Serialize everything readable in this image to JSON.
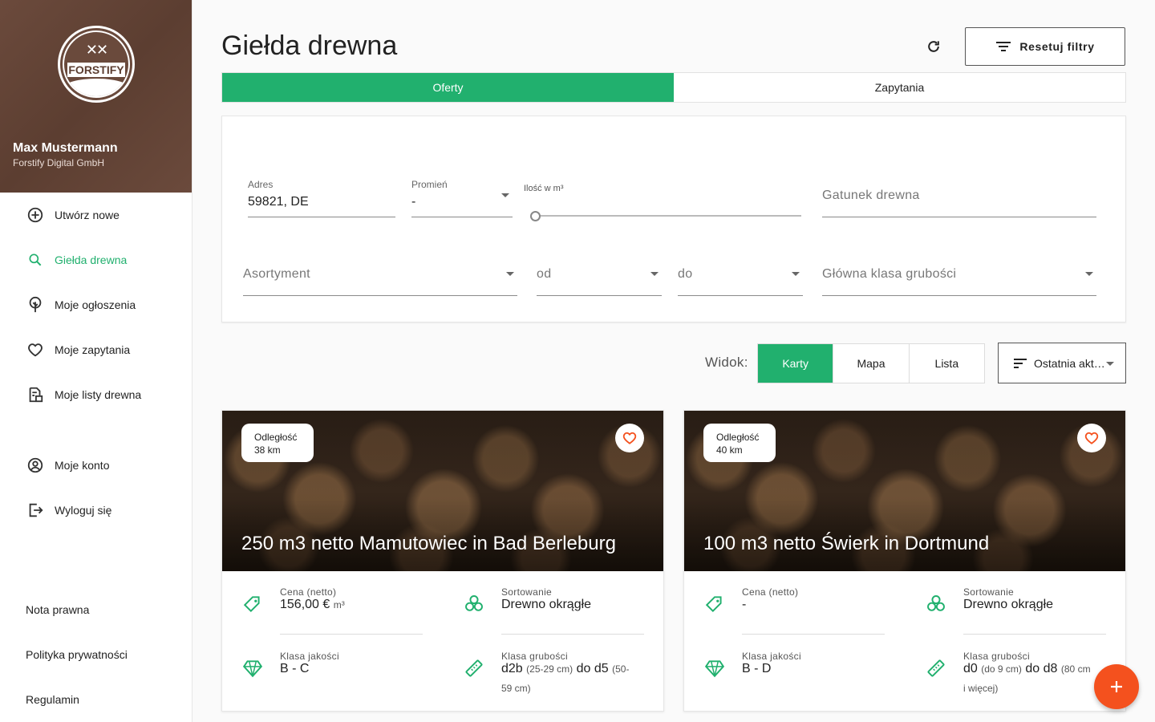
{
  "user": {
    "name": "Max Mustermann",
    "company": "Forstify Digital GmbH"
  },
  "logo_text": "FORSTIFY",
  "nav": {
    "create": "Utwórz nowe",
    "exchange": "Giełda drewna",
    "my_listings": "Moje ogłoszenia",
    "my_requests": "Moje zapytania",
    "my_lists": "Moje listy drewna",
    "account": "Moje konto",
    "logout": "Wyloguj się"
  },
  "footer_links": {
    "legal": "Nota prawna",
    "privacy": "Polityka prywatności",
    "terms": "Regulamin"
  },
  "page": {
    "title": "Giełda drewna",
    "reset_filters": "Resetuj filtry"
  },
  "tabs": {
    "offers": "Oferty",
    "requests": "Zapytania"
  },
  "filters": {
    "address_label": "Adres",
    "address_value": "59821, DE",
    "radius_label": "Promień",
    "radius_value": "-",
    "quantity_label": "Ilość w m³",
    "species_placeholder": "Gatunek drewna",
    "assortment_placeholder": "Asortyment",
    "from_placeholder": "od",
    "to_placeholder": "do",
    "diameter_placeholder": "Główna klasa grubości"
  },
  "view": {
    "label": "Widok:",
    "cards": "Karty",
    "map": "Mapa",
    "list": "Lista",
    "sort": "Ostatnia aktualizacja"
  },
  "colors": {
    "accent": "#21b06e",
    "fab": "#f4511e",
    "sidebar_brown": "#5c3e31"
  },
  "offers": [
    {
      "distance_label": "Odległość",
      "distance_value": "38 km",
      "title": "250 m3 netto Mamutowiec in Bad Berleburg",
      "price_label": "Cena (netto)",
      "price_value": "156,00 €",
      "price_unit": "m³",
      "sorting_label": "Sortowanie",
      "sorting_value": "Drewno okrągłe",
      "quality_label": "Klasa jakości",
      "quality_value": "B - C",
      "diameter_label": "Klasa grubości",
      "diameter_from": "d2b",
      "diameter_from_range": "(25-29 cm)",
      "diameter_to": "do d5",
      "diameter_to_range_start": "(50-",
      "diameter_to_range_end": "59 cm)"
    },
    {
      "distance_label": "Odległość",
      "distance_value": "40 km",
      "title": "100 m3 netto Świerk in Dortmund",
      "price_label": "Cena (netto)",
      "price_value": "-",
      "sorting_label": "Sortowanie",
      "sorting_value": "Drewno okrągłe",
      "quality_label": "Klasa jakości",
      "quality_value": "B - D",
      "diameter_label": "Klasa grubości",
      "diameter_from": "d0",
      "diameter_from_range": "(do 9 cm)",
      "diameter_to": "do d8",
      "diameter_to_range_start": "(80 cm",
      "diameter_to_range_end": "i więcej)"
    }
  ]
}
